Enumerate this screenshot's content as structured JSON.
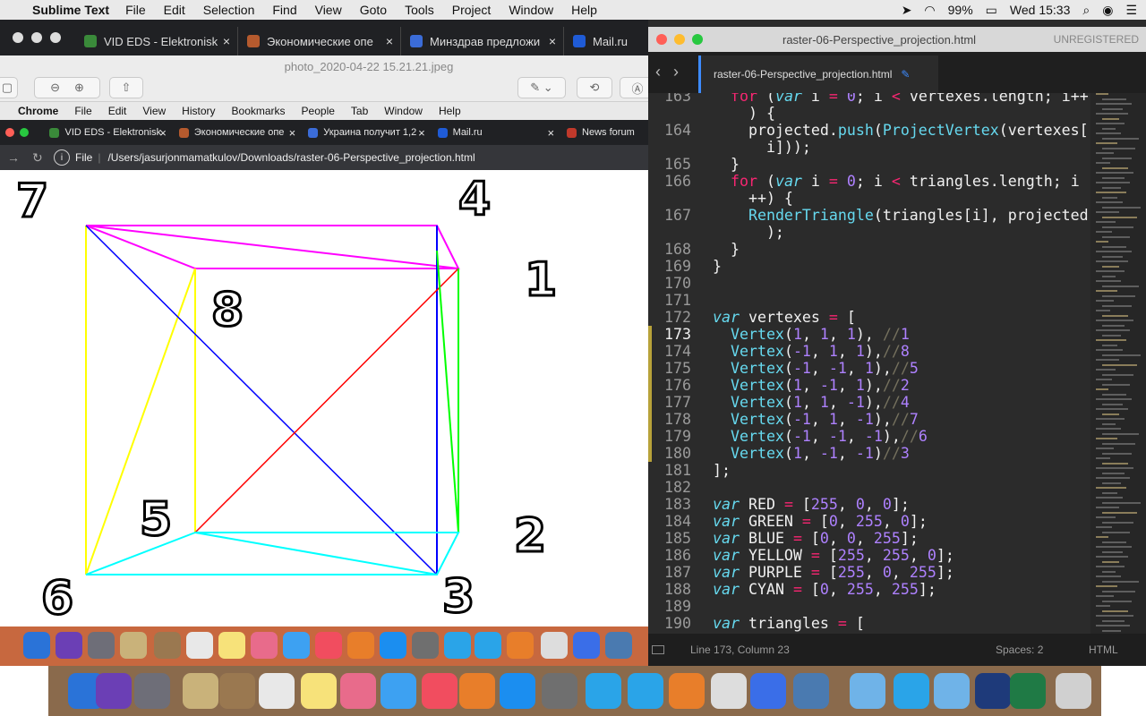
{
  "menubar": {
    "app": "Sublime Text",
    "items": [
      "File",
      "Edit",
      "Selection",
      "Find",
      "View",
      "Goto",
      "Tools",
      "Project",
      "Window",
      "Help"
    ],
    "battery": "99%",
    "clock": "Wed 15:33"
  },
  "preview": {
    "tabs": [
      "VID EDS - Elektronisk",
      "Экономические опе",
      "Минздрав предложи",
      "Mail.ru"
    ],
    "title": "photo_2020-04-22 15.21.21.jpeg"
  },
  "chrome": {
    "menu": [
      "Chrome",
      "File",
      "Edit",
      "View",
      "History",
      "Bookmarks",
      "People",
      "Tab",
      "Window",
      "Help"
    ],
    "tabs": [
      "VID EDS - Elektronisk",
      "Экономические опе",
      "Украина получит 1,2",
      "Mail.ru",
      "News forum"
    ],
    "addr_prefix": "File",
    "url": "/Users/jasurjonmamatkulov/Downloads/raster-06-Perspective_projection.html",
    "labels": [
      "7",
      "4",
      "1",
      "8",
      "5",
      "2",
      "6",
      "3"
    ]
  },
  "sublime": {
    "title": "raster-06-Perspective_projection.html",
    "unregistered": "UNREGISTERED",
    "tab": "raster-06-Perspective_projection.html",
    "status_pos": "Line 173, Column 23",
    "status_spaces": "Spaces: 2",
    "status_syntax": "HTML",
    "lines": [
      {
        "n": "163",
        "t": "  for (var i = 0; i < vertexes.length; i++"
      },
      {
        "n": "",
        "t": "    ) {"
      },
      {
        "n": "164",
        "t": "    projected.push(ProjectVertex(vertexes["
      },
      {
        "n": "",
        "t": "      i]));"
      },
      {
        "n": "165",
        "t": "  }"
      },
      {
        "n": "166",
        "t": "  for (var i = 0; i < triangles.length; i"
      },
      {
        "n": "",
        "t": "    ++) {"
      },
      {
        "n": "167",
        "t": "    RenderTriangle(triangles[i], projected"
      },
      {
        "n": "",
        "t": "      );"
      },
      {
        "n": "168",
        "t": "  }"
      },
      {
        "n": "169",
        "t": "}"
      },
      {
        "n": "170",
        "t": ""
      },
      {
        "n": "171",
        "t": ""
      },
      {
        "n": "172",
        "t": "var vertexes = ["
      },
      {
        "n": "173",
        "t": "  Vertex(1, 1, 1), //1"
      },
      {
        "n": "174",
        "t": "  Vertex(-1, 1, 1),//8"
      },
      {
        "n": "175",
        "t": "  Vertex(-1, -1, 1),//5"
      },
      {
        "n": "176",
        "t": "  Vertex(1, -1, 1),//2"
      },
      {
        "n": "177",
        "t": "  Vertex(1, 1, -1),//4"
      },
      {
        "n": "178",
        "t": "  Vertex(-1, 1, -1),//7"
      },
      {
        "n": "179",
        "t": "  Vertex(-1, -1, -1),//6"
      },
      {
        "n": "180",
        "t": "  Vertex(1, -1, -1)//3"
      },
      {
        "n": "181",
        "t": "];"
      },
      {
        "n": "182",
        "t": ""
      },
      {
        "n": "183",
        "t": "var RED = [255, 0, 0];"
      },
      {
        "n": "184",
        "t": "var GREEN = [0, 255, 0];"
      },
      {
        "n": "185",
        "t": "var BLUE = [0, 0, 255];"
      },
      {
        "n": "186",
        "t": "var YELLOW = [255, 255, 0];"
      },
      {
        "n": "187",
        "t": "var PURPLE = [255, 0, 255];"
      },
      {
        "n": "188",
        "t": "var CYAN = [0, 255, 255];"
      },
      {
        "n": "189",
        "t": ""
      },
      {
        "n": "190",
        "t": "var triangles = ["
      }
    ]
  },
  "colors": {
    "red": "#ff0000",
    "green": "#00ff00",
    "blue": "#0000ff",
    "yellow": "#ffff00",
    "purple": "#ff00ff",
    "cyan": "#00ffff"
  }
}
